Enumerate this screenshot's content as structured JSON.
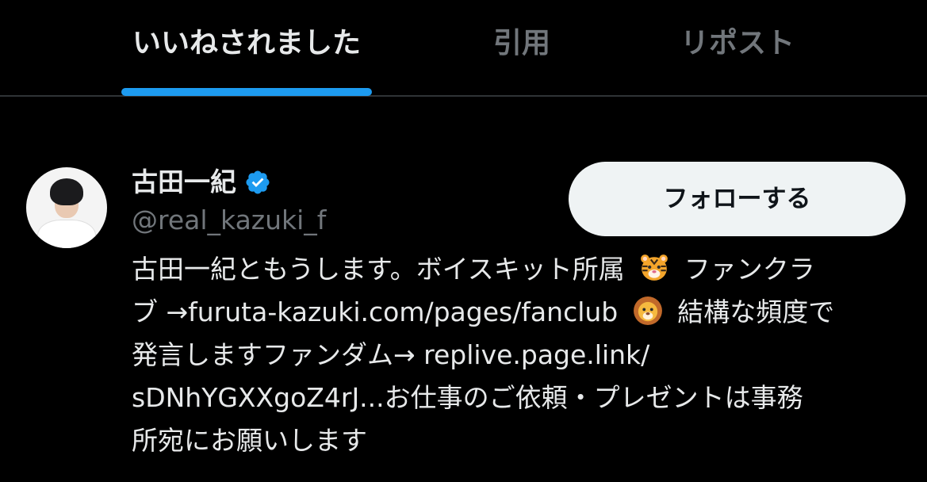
{
  "tabs": [
    {
      "label": "いいねされました",
      "active": true
    },
    {
      "label": "引用",
      "active": false
    },
    {
      "label": "リポスト",
      "active": false
    }
  ],
  "colors": {
    "background": "#000000",
    "accent": "#1d9bf0",
    "primary_text": "#e7e9ea",
    "secondary_text": "#71767b",
    "follow_button_bg": "#eff3f4"
  },
  "user": {
    "display_name": "古田一紀",
    "verified": true,
    "verified_icon": "verified-badge-icon",
    "handle": "@real_kazuki_f",
    "follow_label": "フォローする",
    "bio": {
      "line1_text": "古田一紀ともうします。ボイスキット所属",
      "line1_emoji": "tiger-face-emoji",
      "line1_tail": "ファンクラ",
      "line2_head": "ブ →",
      "line2_link": "furuta-kazuki.com/pages/fanclub",
      "line2_emoji": "lion-face-emoji",
      "line2_tail": "結構な頻度で",
      "line3_head": "発言しますファンダム→ ",
      "line3_link": "replive.page.link/",
      "line4_link": "sDNhYGXXgoZ4rJ...",
      "line4_tail": "お仕事のご依頼・プレゼントは事務",
      "line5": "所宛にお願いします"
    }
  }
}
